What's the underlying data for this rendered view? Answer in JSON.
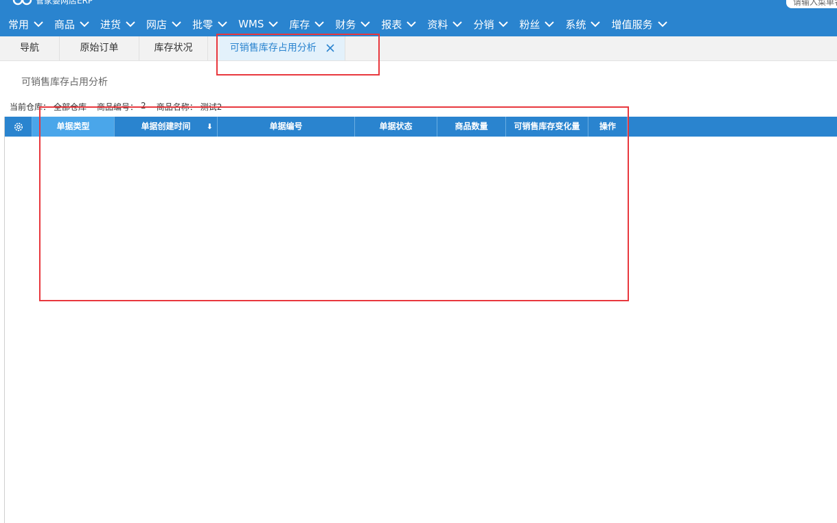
{
  "brand": {
    "name": "管家婆网店ERP"
  },
  "search": {
    "placeholder": "请输入菜单名"
  },
  "nav": [
    {
      "label": "常用"
    },
    {
      "label": "商品"
    },
    {
      "label": "进货"
    },
    {
      "label": "网店"
    },
    {
      "label": "批零"
    },
    {
      "label": "WMS"
    },
    {
      "label": "库存"
    },
    {
      "label": "财务"
    },
    {
      "label": "报表"
    },
    {
      "label": "资料"
    },
    {
      "label": "分销"
    },
    {
      "label": "粉丝"
    },
    {
      "label": "系统"
    },
    {
      "label": "增值服务"
    }
  ],
  "tabs": [
    {
      "label": "导航"
    },
    {
      "label": "原始订单"
    },
    {
      "label": "库存状况"
    },
    {
      "label": "可销售库存占用分析"
    }
  ],
  "page": {
    "title": "可销售库存占用分析",
    "filters": {
      "warehouse_label": "当前仓库：",
      "warehouse_value": "全部仓库",
      "code_label": "商品编号：",
      "code_value": "2",
      "name_label": "商品名称：",
      "name_value": "测试2"
    }
  },
  "grid": {
    "columns": [
      {
        "label": "单据类型"
      },
      {
        "label": "单据创建时间"
      },
      {
        "label": "单据编号"
      },
      {
        "label": "单据状态"
      },
      {
        "label": "商品数量"
      },
      {
        "label": "可销售库存变化量"
      },
      {
        "label": "操作"
      }
    ],
    "rows": []
  },
  "colors": {
    "primary": "#2a84cf",
    "tab_active_bg": "#e3f1fb",
    "highlight": "#e8363c"
  }
}
